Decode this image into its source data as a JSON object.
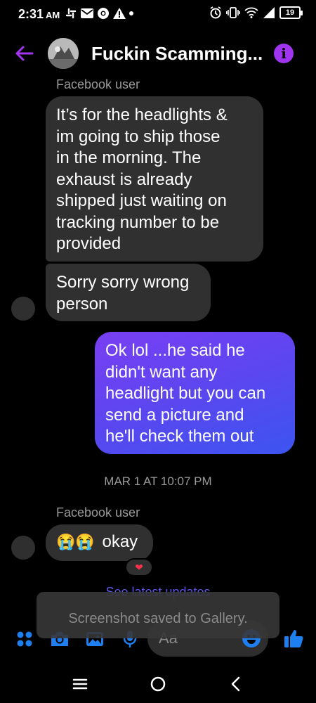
{
  "status_bar": {
    "time": "2:31",
    "ampm": "AM",
    "battery": "19"
  },
  "header": {
    "title": "Fuckin Scamming...",
    "info_icon": "i"
  },
  "messages": {
    "sender_label_1": "Facebook user",
    "msg1_lines": [
      "It’s for the headlights &",
      "im going to ship those",
      "in the morning. The",
      "exhaust is already",
      "shipped just waiting on",
      "tracking number to be",
      "provided"
    ],
    "msg2_lines": [
      "Sorry sorry wrong",
      "person"
    ],
    "msg3_lines": [
      "Ok lol ...he said he",
      "didn't want any",
      "headlight but you can",
      "send a picture and",
      "he'll check them out"
    ],
    "timestamp": "MAR 1 AT 10:07 PM",
    "sender_label_2": "Facebook user",
    "msg4_emoji": "😭😭",
    "msg4_text": "okay",
    "reaction": "❤"
  },
  "see_latest": "See latest updates",
  "toast": "Screenshot saved to Gallery.",
  "composer": {
    "placeholder": "Aa"
  },
  "colors": {
    "accent": "#a034f0",
    "link": "#5f55e8",
    "outgoing_start": "#7a3ff3",
    "outgoing_end": "#3c55f0",
    "incoming_bubble": "#303030",
    "composer_blue": "#1e7ff0",
    "reaction": "#f5304a"
  },
  "icons": [
    "back-arrow-icon",
    "info-icon",
    "apps-icon",
    "camera-icon",
    "image-icon",
    "microphone-icon",
    "emoji-icon",
    "thumbs-up-icon",
    "menu-icon",
    "home-icon",
    "back-icon"
  ]
}
